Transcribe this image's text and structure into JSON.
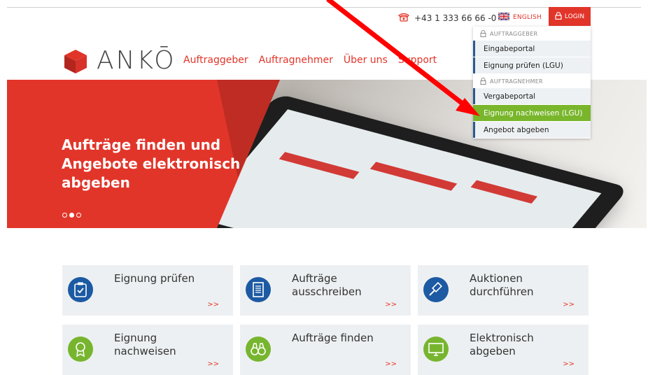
{
  "topbar": {
    "phone": "+43 1 333 66 66 -0",
    "language": "ENGLISH",
    "login": "LOGIN"
  },
  "logo": {
    "text": "ANKŌ"
  },
  "nav": {
    "items": [
      "Auftraggeber",
      "Auftragnehmer",
      "Über uns",
      "Support"
    ]
  },
  "hero": {
    "title": "Aufträge finden und Angebote elektronisch abgeben",
    "slides_total": 3,
    "slide_active": 2
  },
  "dropdown": {
    "group1_title": "AUFTRAGGEBER",
    "group1_items": [
      "Eingabeportal",
      "Eignung prüfen (LGU)"
    ],
    "group2_title": "AUFTRAGNEHMER",
    "group2_items": [
      "Vergabeportal",
      "Eignung nachweisen (LGU)",
      "Angebot abgeben"
    ],
    "active_item": "Eignung nachweisen (LGU)"
  },
  "tiles": [
    {
      "label": "Eignung prüfen",
      "more": ">>",
      "icon": "clipboard-check-icon"
    },
    {
      "label": "Aufträge ausschreiben",
      "more": ">>",
      "icon": "document-icon"
    },
    {
      "label": "Auktionen durchführen",
      "more": ">>",
      "icon": "gavel-icon"
    },
    {
      "label": "Eignung nachweisen",
      "more": ">>",
      "icon": "award-icon"
    },
    {
      "label": "Aufträge finden",
      "more": ">>",
      "icon": "binoculars-icon"
    },
    {
      "label": "Elektronisch abgeben",
      "more": ">>",
      "icon": "monitor-icon"
    }
  ],
  "colors": {
    "brand_red": "#e2352a",
    "brand_blue": "#1c5aa3",
    "brand_green": "#77b52f",
    "highlight_green": "#79b62c",
    "annotation_red": "#ff0000"
  }
}
